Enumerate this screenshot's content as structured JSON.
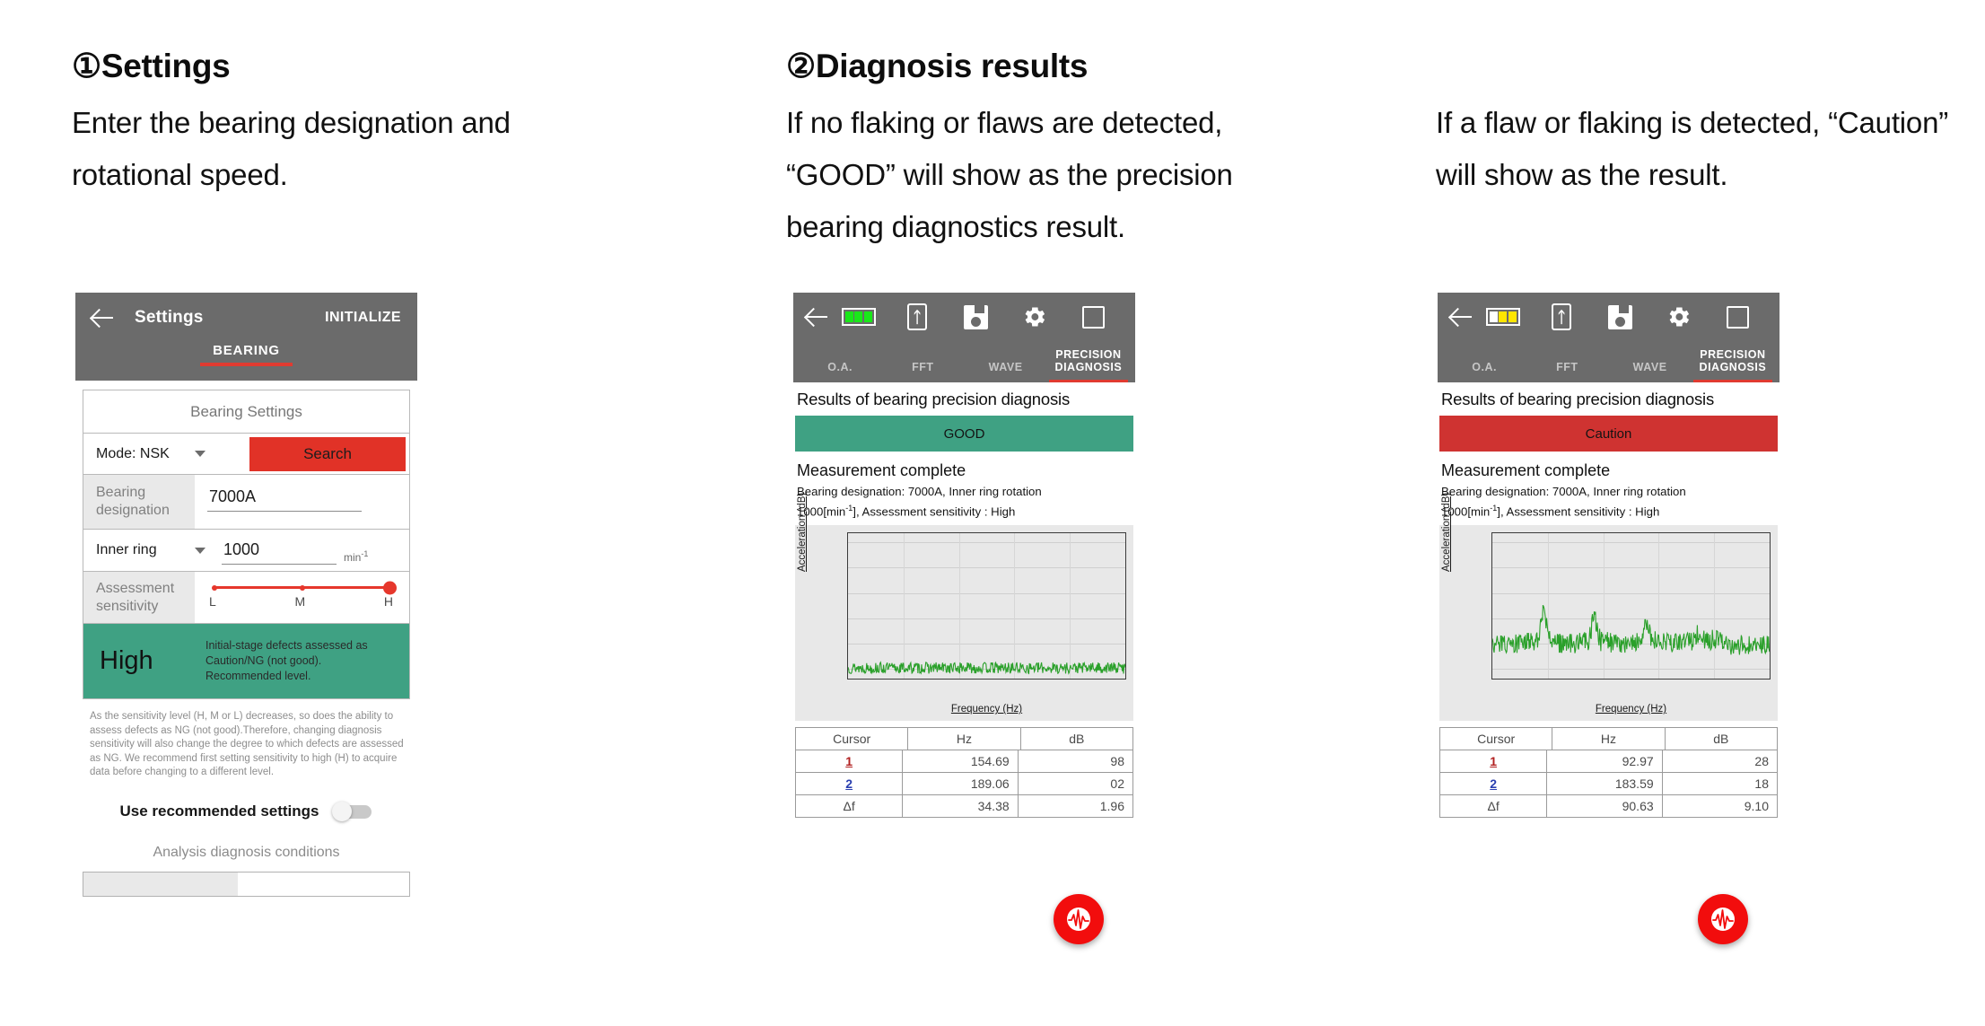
{
  "columns": [
    {
      "title": "①Settings",
      "desc": "Enter the bearing designation and rotational speed."
    },
    {
      "title": "②Diagnosis results",
      "desc": "If no flaking or flaws are detected, “GOOD” will show as the precision bearing diagnostics result."
    },
    {
      "title": "",
      "desc": "If a flaw or flaking is detected, “Caution” will show as the result."
    }
  ],
  "settings_phone": {
    "appbar": {
      "back_icon": "back-arrow-icon",
      "title": "Settings",
      "action": "INITIALIZE",
      "tab": "BEARING"
    },
    "card_title": "Bearing Settings",
    "mode": {
      "label": "Mode: NSK",
      "dropdown_icon": "chevron-down-icon",
      "search_label": "Search"
    },
    "bearing": {
      "label": "Bearing designation",
      "value": "7000A"
    },
    "rotation": {
      "label": "Inner ring",
      "dropdown_icon": "chevron-down-icon",
      "value": "1000",
      "unit": "min",
      "unit_exp": "-1"
    },
    "sensitivity": {
      "label": "Assessment sensitivity",
      "ticks": [
        "L",
        "M",
        "H"
      ],
      "selected": "H"
    },
    "high_banner": {
      "word": "High",
      "desc": "Initial-stage defects assessed as Caution/NG (not good). Recommended level."
    },
    "note": "As the sensitivity level (H, M or L) decreases, so does the ability to assess defects as NG (not good).Therefore, changing diagnosis sensitivity will also change the degree to which defects are assessed as NG. We recommend first setting sensitivity to high (H) to acquire data before changing to a different level.",
    "toggle_label": "Use recommended settings",
    "toggle_state": "off",
    "section_sub": "Analysis diagnosis conditions"
  },
  "result_phones": [
    {
      "appbar": {
        "back_icon": "back-arrow-icon",
        "battery_icon": "battery-icon",
        "battery_cells": [
          "#19e819",
          "#19e819",
          "#19e819"
        ],
        "bluetooth_icon": "bluetooth-icon",
        "save_icon": "save-icon",
        "gear_icon": "gear-icon",
        "stop_icon": "stop-square-icon",
        "tabs": [
          "O.A.",
          "FFT",
          "WAVE",
          "PRECISION DIAGNOSIS"
        ],
        "active_tab": "PRECISION DIAGNOSIS"
      },
      "results_title": "Results of bearing precision diagnosis",
      "verdict": "GOOD",
      "verdict_color": "#3fa183",
      "measurement_status": "Measurement complete",
      "meas_line1": "Bearing designation: 7000A, Inner ring rotation",
      "meas_line2_pre": "1000[min",
      "meas_line2_exp": "-1",
      "meas_line2_post": "], Assessment sensitivity : High",
      "table": {
        "headers": [
          "Cursor",
          "Hz",
          "dB"
        ],
        "rows": [
          [
            "1",
            "154.69",
            "98"
          ],
          [
            "2",
            "189.06",
            "02"
          ],
          [
            "Δf",
            "34.38",
            "1.96"
          ]
        ]
      },
      "fab_icon": "waveform-icon"
    },
    {
      "appbar": {
        "back_icon": "back-arrow-icon",
        "battery_icon": "battery-icon",
        "battery_cells": [
          "#ffffff",
          "#ffe600",
          "#ffe600"
        ],
        "bluetooth_icon": "bluetooth-icon",
        "save_icon": "save-icon",
        "gear_icon": "gear-icon",
        "stop_icon": "stop-square-icon",
        "tabs": [
          "O.A.",
          "FFT",
          "WAVE",
          "PRECISION DIAGNOSIS"
        ],
        "active_tab": "PRECISION DIAGNOSIS"
      },
      "results_title": "Results of bearing precision diagnosis",
      "verdict": "Caution",
      "verdict_color": "#cf3331",
      "measurement_status": "Measurement complete",
      "meas_line1": "Bearing designation: 7000A, Inner ring rotation",
      "meas_line2_pre": "1000[min",
      "meas_line2_exp": "-1",
      "meas_line2_post": "], Assessment sensitivity : High",
      "table": {
        "headers": [
          "Cursor",
          "Hz",
          "dB"
        ],
        "rows": [
          [
            "1",
            "92.97",
            "28"
          ],
          [
            "2",
            "183.59",
            "18"
          ],
          [
            "Δf",
            "90.63",
            "9.10"
          ]
        ]
      },
      "fab_icon": "waveform-icon"
    }
  ],
  "chart_data": [
    {
      "type": "line",
      "title": "",
      "xlabel": "Frequency (Hz)",
      "ylabel": "Acceleration (dB)",
      "xlim": [
        0,
        500
      ],
      "ylim": [
        -128,
        -13
      ],
      "xticks": [
        100,
        200,
        300,
        400,
        500
      ],
      "yticks": [
        -20,
        -40,
        -60,
        -80,
        -100,
        -120
      ],
      "grid": true,
      "series": [
        {
          "name": "spectrum-good",
          "color": "#2aa02a",
          "baseline": -120,
          "noise_amplitude": 4.5,
          "peaks": []
        }
      ]
    },
    {
      "type": "line",
      "title": "",
      "xlabel": "Frequency (Hz)",
      "ylabel": "Acceleration (dB)",
      "xlim": [
        0,
        500
      ],
      "ylim": [
        -128,
        -13
      ],
      "xticks": [
        100,
        200,
        300,
        400,
        500
      ],
      "yticks": [
        -20,
        -40,
        -60,
        -80,
        -100,
        -120
      ],
      "grid": true,
      "series": [
        {
          "name": "spectrum-caution",
          "color": "#2aa02a",
          "baseline": -102,
          "noise_amplitude": 8,
          "peaks": [
            {
              "x": 93,
              "y": -73
            },
            {
              "x": 184,
              "y": -78
            },
            {
              "x": 277,
              "y": -83
            },
            {
              "x": 370,
              "y": -94
            }
          ]
        }
      ]
    }
  ]
}
